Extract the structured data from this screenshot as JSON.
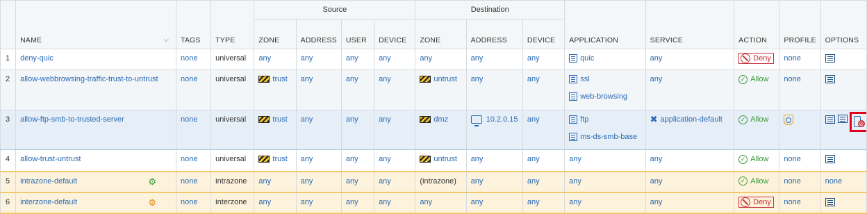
{
  "headers": {
    "source_group": "Source",
    "destination_group": "Destination",
    "columns": [
      "NAME",
      "TAGS",
      "TYPE",
      "ZONE",
      "ADDRESS",
      "USER",
      "DEVICE",
      "ZONE",
      "ADDRESS",
      "DEVICE",
      "APPLICATION",
      "SERVICE",
      "ACTION",
      "PROFILE",
      "OPTIONS"
    ]
  },
  "rows": [
    {
      "num": "1",
      "name": "deny-quic",
      "tags": "none",
      "type": "universal",
      "src_zone": "any",
      "src_addr": "any",
      "src_user": "any",
      "src_device": "any",
      "dst_zone": "any",
      "dst_addr": "any",
      "dst_device": "any",
      "apps": [
        "quic"
      ],
      "service": "any",
      "action": "Deny",
      "profile": "none",
      "options": ""
    },
    {
      "num": "2",
      "name": "allow-webbrowsing-traffic-trust-to-untrust",
      "tags": "none",
      "type": "universal",
      "src_zone": "trust",
      "src_addr": "any",
      "src_user": "any",
      "src_device": "any",
      "dst_zone": "untrust",
      "dst_addr": "any",
      "dst_device": "any",
      "apps": [
        "ssl",
        "web-browsing"
      ],
      "service": "any",
      "action": "Allow",
      "profile": "none",
      "options": ""
    },
    {
      "num": "3",
      "name": "allow-ftp-smb-to-trusted-server",
      "tags": "none",
      "type": "universal",
      "src_zone": "trust",
      "src_addr": "any",
      "src_user": "any",
      "src_device": "any",
      "dst_zone": "dmz",
      "dst_addr": "10.2.0.15",
      "dst_device": "any",
      "apps": [
        "ftp",
        "ms-ds-smb-base"
      ],
      "service": "application-default",
      "action": "Allow",
      "profile": "",
      "options": ""
    },
    {
      "num": "4",
      "name": "allow-trust-untrust",
      "tags": "none",
      "type": "universal",
      "src_zone": "trust",
      "src_addr": "any",
      "src_user": "any",
      "src_device": "any",
      "dst_zone": "untrust",
      "dst_addr": "any",
      "dst_device": "any",
      "apps": [
        "any"
      ],
      "service": "any",
      "action": "Allow",
      "profile": "none",
      "options": ""
    },
    {
      "num": "5",
      "name": "intrazone-default",
      "tags": "none",
      "type": "intrazone",
      "src_zone": "any",
      "src_addr": "any",
      "src_user": "any",
      "src_device": "any",
      "dst_zone": "(intrazone)",
      "dst_addr": "any",
      "dst_device": "any",
      "apps": [
        "any"
      ],
      "service": "any",
      "action": "Allow",
      "profile": "none",
      "options": "none"
    },
    {
      "num": "6",
      "name": "interzone-default",
      "tags": "none",
      "type": "interzone",
      "src_zone": "any",
      "src_addr": "any",
      "src_user": "any",
      "src_device": "any",
      "dst_zone": "any",
      "dst_addr": "any",
      "dst_device": "any",
      "apps": [
        "any"
      ],
      "service": "any",
      "action": "Deny",
      "profile": "none",
      "options": ""
    }
  ],
  "colors": {
    "link": "#2b69b3",
    "allow": "#3a9a3a",
    "deny": "#c8323c",
    "highlight": "#e0001b",
    "default_row": "#fdf3dc"
  }
}
